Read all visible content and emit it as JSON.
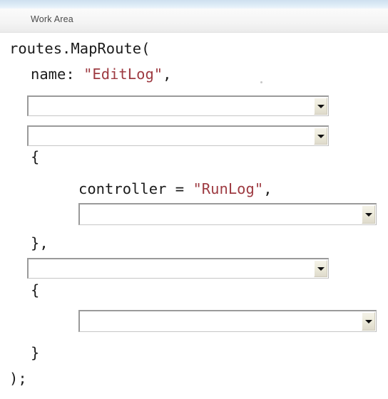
{
  "header": {
    "title": "Work Area",
    "strip_color": "#d8e8f4",
    "band_color": "#f4f4f4",
    "title_color": "#4a4a4a"
  },
  "editor": {
    "background": "#ffffff",
    "text_color": "#1b1b1b",
    "string_color": "#9e3b42",
    "code_lines": [
      {
        "id": "line-1",
        "indent": 0,
        "text": "routes.MapRoute("
      },
      {
        "id": "line-2",
        "indent": 1,
        "prefix": "name: ",
        "string": "\"EditLog\"",
        "suffix": ","
      },
      {
        "id": "line-3",
        "indent": 1,
        "text": "{"
      },
      {
        "id": "line-4",
        "indent": 3,
        "prefix": "controller = ",
        "string": "\"RunLog\"",
        "suffix": ","
      },
      {
        "id": "line-5",
        "indent": 1,
        "text": "},"
      },
      {
        "id": "line-6",
        "indent": 1,
        "text": "{"
      },
      {
        "id": "line-7",
        "indent": 1,
        "text": "}"
      },
      {
        "id": "line-8",
        "indent": 0,
        "text": ");"
      }
    ]
  },
  "dropdowns": [
    {
      "id": "dropdown-1",
      "value": "",
      "placeholder": "",
      "arrow": "chevron-down-icon"
    },
    {
      "id": "dropdown-2",
      "value": "",
      "placeholder": "",
      "arrow": "chevron-down-icon"
    },
    {
      "id": "dropdown-3",
      "value": "",
      "placeholder": "",
      "arrow": "chevron-down-icon"
    },
    {
      "id": "dropdown-4",
      "value": "",
      "placeholder": "",
      "arrow": "chevron-down-icon"
    },
    {
      "id": "dropdown-5",
      "value": "",
      "placeholder": "",
      "arrow": "chevron-down-icon"
    }
  ]
}
